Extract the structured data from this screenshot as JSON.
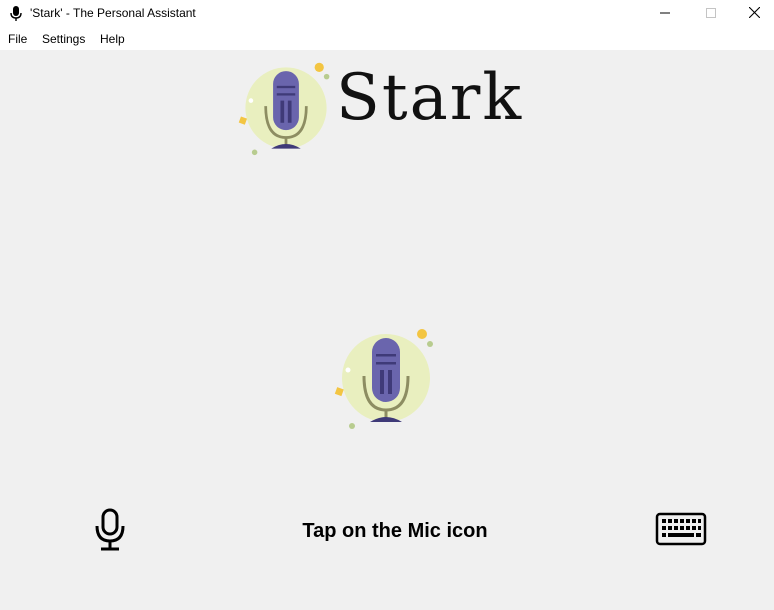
{
  "window": {
    "title": "'Stark' - The Personal Assistant",
    "icon": "microphone-icon",
    "controls": [
      "minimize-icon",
      "maximize-icon",
      "close-icon"
    ]
  },
  "menu": {
    "items": [
      {
        "label": "File"
      },
      {
        "label": "Settings"
      },
      {
        "label": "Help"
      }
    ]
  },
  "header": {
    "app_name": "Stark",
    "logo_icon": "stark-microphone-logo-icon"
  },
  "main": {
    "center_icon": "stark-microphone-logo-icon",
    "status_text": "Tap on the Mic icon",
    "mic_button_icon": "microphone-icon",
    "keyboard_button_icon": "keyboard-icon"
  },
  "colors": {
    "window_background": "#f0f0f0",
    "titlebar_background": "#ffffff",
    "logo_circle": "#e9efbf",
    "mic_body": "#6a65ad",
    "mic_detail": "#3f3a78",
    "mic_stand": "#8d8d62",
    "accent_yellow": "#f3c542",
    "accent_green": "#b8cc8f"
  }
}
